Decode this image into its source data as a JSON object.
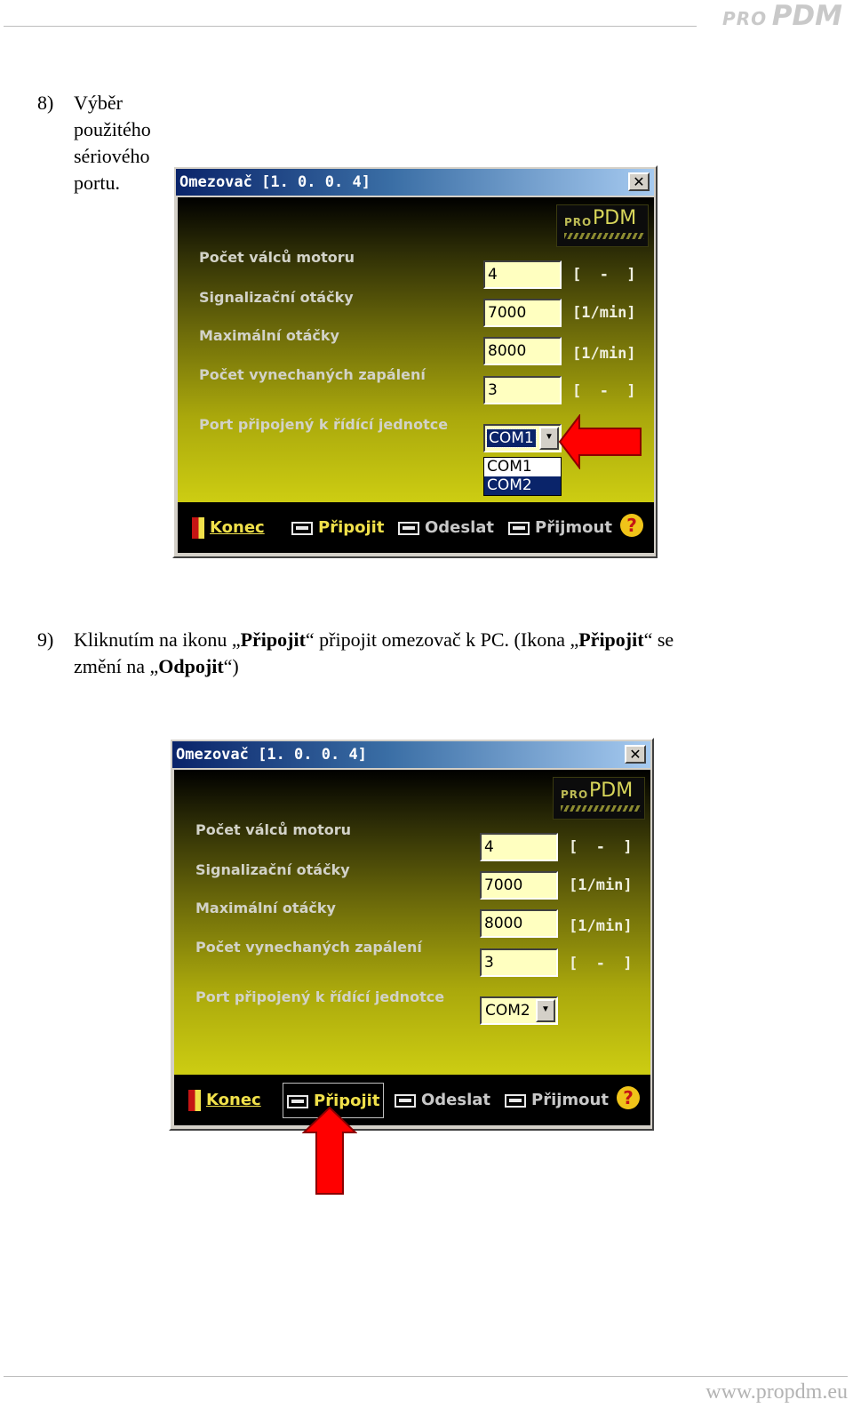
{
  "header": {
    "logo_pro": "PRO",
    "logo_pdm": "PDM"
  },
  "footer": {
    "url": "www.propdm.eu"
  },
  "step8": {
    "number": "8)",
    "text": "Výběr použitého sériového portu."
  },
  "step9": {
    "number": "9)",
    "t1": "Kliknutím na ikonu „",
    "b1": "Připojit",
    "t2": "“ připojit omezovač k PC. (Ikona „",
    "b2": "Připojit",
    "t3": "“ se",
    "t4": "změní na „",
    "b3": "Odpojit",
    "t5": "“)"
  },
  "window1": {
    "title": "Omezovač [1. 0. 0. 4]",
    "close": "✕",
    "logo_pro": "PRO",
    "logo_pdm": "PDM",
    "fields": [
      {
        "label": "Počet válců motoru",
        "value": "4",
        "unit": "[  -  ]"
      },
      {
        "label": "Signalizační otáčky",
        "value": "7000",
        "unit": "[1/min]"
      },
      {
        "label": "Maximální otáčky",
        "value": "8000",
        "unit": "[1/min]"
      },
      {
        "label": "Počet vynechaných zapálení",
        "value": "3",
        "unit": "[  -  ]"
      }
    ],
    "port_label": "Port připojený k řídící jednotce",
    "port_value": "COM1",
    "port_options": [
      "COM1",
      "COM2"
    ],
    "port_highlighted": "COM2",
    "toolbar": {
      "konec": "Konec",
      "pripojit": "Připojit",
      "odeslat": "Odeslat",
      "prijmout": "Přijmout",
      "help": "?"
    }
  },
  "window2": {
    "title": "Omezovač [1. 0. 0. 4]",
    "close": "✕",
    "logo_pro": "PRO",
    "logo_pdm": "PDM",
    "fields": [
      {
        "label": "Počet válců motoru",
        "value": "4",
        "unit": "[  -  ]"
      },
      {
        "label": "Signalizační otáčky",
        "value": "7000",
        "unit": "[1/min]"
      },
      {
        "label": "Maximální otáčky",
        "value": "8000",
        "unit": "[1/min]"
      },
      {
        "label": "Počet vynechaných zapálení",
        "value": "3",
        "unit": "[  -  ]"
      }
    ],
    "port_label": "Port připojený k řídící jednotce",
    "port_value": "COM2",
    "toolbar": {
      "konec": "Konec",
      "pripojit": "Připojit",
      "odeslat": "Odeslat",
      "prijmout": "Přijmout",
      "help": "?"
    }
  },
  "colors": {
    "arrow": "#ff0000",
    "field_bg": "#ffffc0",
    "title_dark": "#0a246a",
    "toolbar_gold": "#f0e04a"
  }
}
